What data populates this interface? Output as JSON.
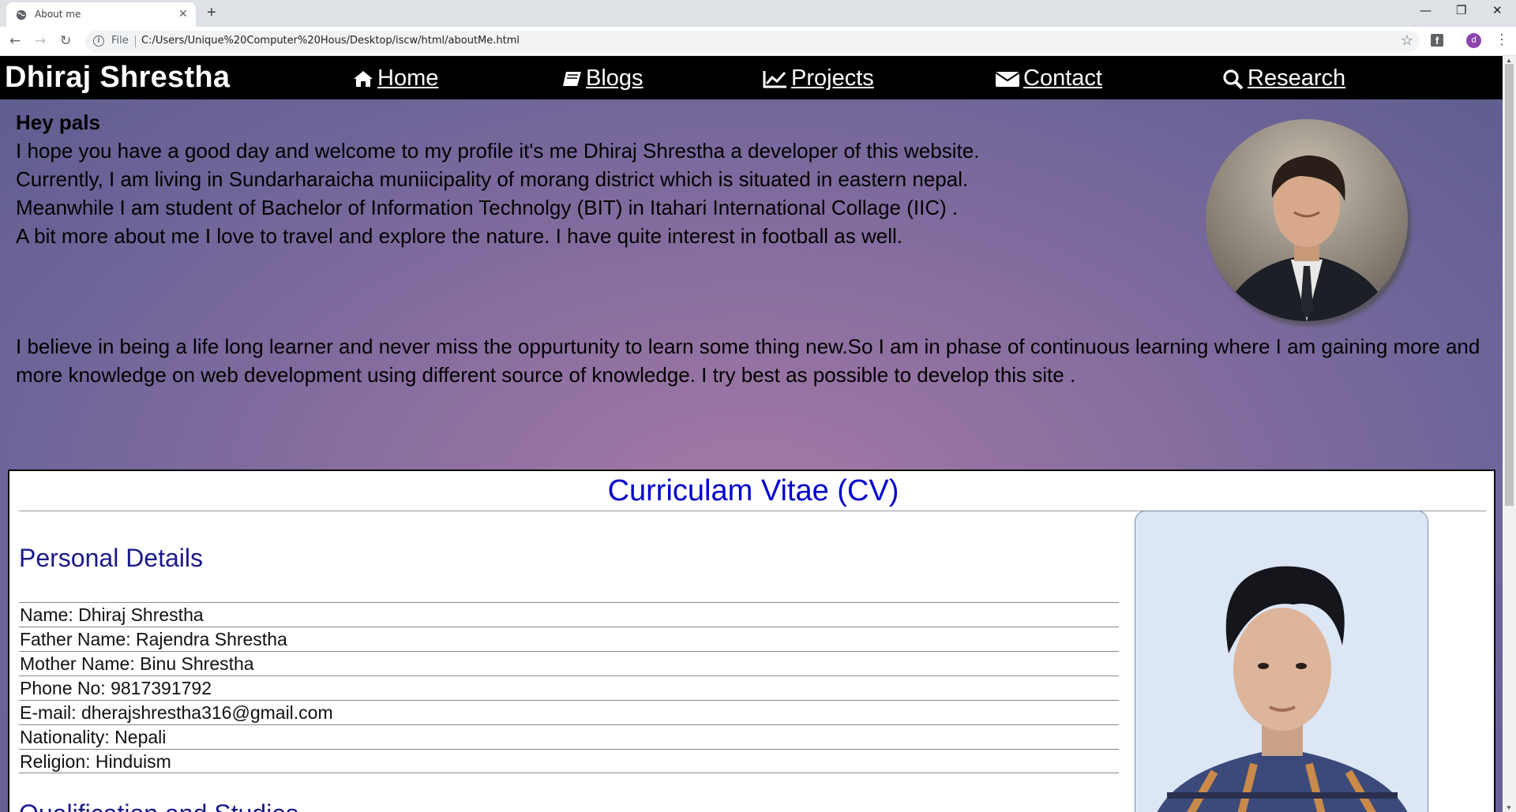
{
  "browser": {
    "tab_title": "About me",
    "tab_close": "✕",
    "new_tab": "+",
    "file_label": "File",
    "url": "C:/Users/Unique%20Computer%20Hous/Desktop/iscw/html/aboutMe.html",
    "profile_initial": "d",
    "window_controls": [
      "—",
      "❐",
      "✕"
    ]
  },
  "nav": {
    "brand": "Dhiraj Shrestha",
    "links": [
      {
        "label": "Home",
        "icon": "home-icon"
      },
      {
        "label": "Blogs",
        "icon": "book-icon"
      },
      {
        "label": "Projects",
        "icon": "chart-line-icon"
      },
      {
        "label": "Contact",
        "icon": "envelope-icon"
      },
      {
        "label": "Research",
        "icon": "search-icon"
      }
    ]
  },
  "about": {
    "greeting": "Hey pals",
    "lines": [
      "I hope you have a good day and welcome to my profile it's me Dhiraj Shrestha a developer of this website.",
      "Currently, I am living in Sundarharaicha muniicipality of morang district which is situated in eastern nepal.",
      "Meanwhile I am student of Bachelor of Information Technolgy (BIT) in Itahari International Collage (IIC) .",
      "A bit more about me I love to travel and explore the nature. I have quite interest in football as well."
    ],
    "paragraph2": "I believe in being a life long learner and never miss the oppurtunity to learn some thing new.So I am in phase of continuous learning where I am gaining more and more knowledge on web development using different source of knowledge. I try best as possible to develop this site ."
  },
  "cv": {
    "title": "Curriculam Vitae (CV)",
    "personal_heading": "Personal Details",
    "details": [
      "Name: Dhiraj Shrestha",
      "Father Name: Rajendra Shrestha",
      "Mother Name: Binu Shrestha",
      "Phone No: 9817391792",
      "E-mail: dherajshrestha316@gmail.com",
      "Nationality: Nepali",
      "Religion: Hinduism"
    ],
    "next_heading": "Qualification and Studies"
  },
  "colors": {
    "nav_bg": "#000000",
    "cv_title": "#0000cd",
    "cv_heading": "#1a1a8a"
  }
}
